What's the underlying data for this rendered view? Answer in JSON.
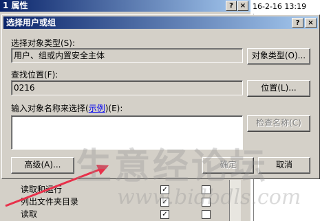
{
  "background_window": {
    "title": "1 属性",
    "help_btn": "?",
    "close_btn": "×",
    "timestamp": "16-2-16 13:19",
    "permissions": [
      {
        "label": "读取和运行",
        "allow": "✓",
        "deny": ""
      },
      {
        "label": "列出文件夹目录",
        "allow": "✓",
        "deny": ""
      },
      {
        "label": "读取",
        "allow": "✓",
        "deny": ""
      }
    ]
  },
  "dialog": {
    "title": "选择用户或组",
    "help_btn": "?",
    "close_btn": "×",
    "object_type_label": "选择对象类型(S):",
    "object_type_value": "用户、组或内置安全主体",
    "object_type_button": "对象类型(O)...",
    "location_label": "查找位置(F):",
    "location_value": "0216",
    "location_button": "位置(L)...",
    "names_label_prefix": "输入对象名称来选择(",
    "names_label_link": "示例",
    "names_label_suffix": ")(E):",
    "names_value": "",
    "check_names_button": "检查名称(C)",
    "advanced_button": "高级(A)...",
    "ok_button": "确定",
    "cancel_button": "取消"
  },
  "watermark": {
    "text": "生意经论坛",
    "url": "www.bidbdls.com"
  },
  "colors": {
    "titlebar_start": "#0a246a",
    "titlebar_end": "#a6caf0",
    "face": "#d4d0c8",
    "arrow": "#e8304a"
  }
}
